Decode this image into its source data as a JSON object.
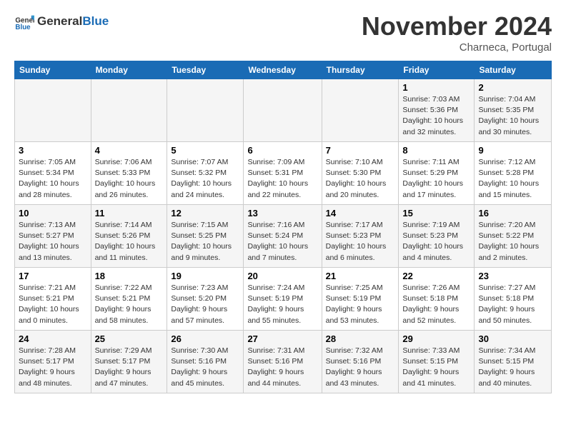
{
  "header": {
    "logo_general": "General",
    "logo_blue": "Blue",
    "month_title": "November 2024",
    "subtitle": "Charneca, Portugal"
  },
  "days_of_week": [
    "Sunday",
    "Monday",
    "Tuesday",
    "Wednesday",
    "Thursday",
    "Friday",
    "Saturday"
  ],
  "weeks": [
    [
      {
        "day": "",
        "info": ""
      },
      {
        "day": "",
        "info": ""
      },
      {
        "day": "",
        "info": ""
      },
      {
        "day": "",
        "info": ""
      },
      {
        "day": "",
        "info": ""
      },
      {
        "day": "1",
        "info": "Sunrise: 7:03 AM\nSunset: 5:36 PM\nDaylight: 10 hours and 32 minutes."
      },
      {
        "day": "2",
        "info": "Sunrise: 7:04 AM\nSunset: 5:35 PM\nDaylight: 10 hours and 30 minutes."
      }
    ],
    [
      {
        "day": "3",
        "info": "Sunrise: 7:05 AM\nSunset: 5:34 PM\nDaylight: 10 hours and 28 minutes."
      },
      {
        "day": "4",
        "info": "Sunrise: 7:06 AM\nSunset: 5:33 PM\nDaylight: 10 hours and 26 minutes."
      },
      {
        "day": "5",
        "info": "Sunrise: 7:07 AM\nSunset: 5:32 PM\nDaylight: 10 hours and 24 minutes."
      },
      {
        "day": "6",
        "info": "Sunrise: 7:09 AM\nSunset: 5:31 PM\nDaylight: 10 hours and 22 minutes."
      },
      {
        "day": "7",
        "info": "Sunrise: 7:10 AM\nSunset: 5:30 PM\nDaylight: 10 hours and 20 minutes."
      },
      {
        "day": "8",
        "info": "Sunrise: 7:11 AM\nSunset: 5:29 PM\nDaylight: 10 hours and 17 minutes."
      },
      {
        "day": "9",
        "info": "Sunrise: 7:12 AM\nSunset: 5:28 PM\nDaylight: 10 hours and 15 minutes."
      }
    ],
    [
      {
        "day": "10",
        "info": "Sunrise: 7:13 AM\nSunset: 5:27 PM\nDaylight: 10 hours and 13 minutes."
      },
      {
        "day": "11",
        "info": "Sunrise: 7:14 AM\nSunset: 5:26 PM\nDaylight: 10 hours and 11 minutes."
      },
      {
        "day": "12",
        "info": "Sunrise: 7:15 AM\nSunset: 5:25 PM\nDaylight: 10 hours and 9 minutes."
      },
      {
        "day": "13",
        "info": "Sunrise: 7:16 AM\nSunset: 5:24 PM\nDaylight: 10 hours and 7 minutes."
      },
      {
        "day": "14",
        "info": "Sunrise: 7:17 AM\nSunset: 5:23 PM\nDaylight: 10 hours and 6 minutes."
      },
      {
        "day": "15",
        "info": "Sunrise: 7:19 AM\nSunset: 5:23 PM\nDaylight: 10 hours and 4 minutes."
      },
      {
        "day": "16",
        "info": "Sunrise: 7:20 AM\nSunset: 5:22 PM\nDaylight: 10 hours and 2 minutes."
      }
    ],
    [
      {
        "day": "17",
        "info": "Sunrise: 7:21 AM\nSunset: 5:21 PM\nDaylight: 10 hours and 0 minutes."
      },
      {
        "day": "18",
        "info": "Sunrise: 7:22 AM\nSunset: 5:21 PM\nDaylight: 9 hours and 58 minutes."
      },
      {
        "day": "19",
        "info": "Sunrise: 7:23 AM\nSunset: 5:20 PM\nDaylight: 9 hours and 57 minutes."
      },
      {
        "day": "20",
        "info": "Sunrise: 7:24 AM\nSunset: 5:19 PM\nDaylight: 9 hours and 55 minutes."
      },
      {
        "day": "21",
        "info": "Sunrise: 7:25 AM\nSunset: 5:19 PM\nDaylight: 9 hours and 53 minutes."
      },
      {
        "day": "22",
        "info": "Sunrise: 7:26 AM\nSunset: 5:18 PM\nDaylight: 9 hours and 52 minutes."
      },
      {
        "day": "23",
        "info": "Sunrise: 7:27 AM\nSunset: 5:18 PM\nDaylight: 9 hours and 50 minutes."
      }
    ],
    [
      {
        "day": "24",
        "info": "Sunrise: 7:28 AM\nSunset: 5:17 PM\nDaylight: 9 hours and 48 minutes."
      },
      {
        "day": "25",
        "info": "Sunrise: 7:29 AM\nSunset: 5:17 PM\nDaylight: 9 hours and 47 minutes."
      },
      {
        "day": "26",
        "info": "Sunrise: 7:30 AM\nSunset: 5:16 PM\nDaylight: 9 hours and 45 minutes."
      },
      {
        "day": "27",
        "info": "Sunrise: 7:31 AM\nSunset: 5:16 PM\nDaylight: 9 hours and 44 minutes."
      },
      {
        "day": "28",
        "info": "Sunrise: 7:32 AM\nSunset: 5:16 PM\nDaylight: 9 hours and 43 minutes."
      },
      {
        "day": "29",
        "info": "Sunrise: 7:33 AM\nSunset: 5:15 PM\nDaylight: 9 hours and 41 minutes."
      },
      {
        "day": "30",
        "info": "Sunrise: 7:34 AM\nSunset: 5:15 PM\nDaylight: 9 hours and 40 minutes."
      }
    ]
  ]
}
